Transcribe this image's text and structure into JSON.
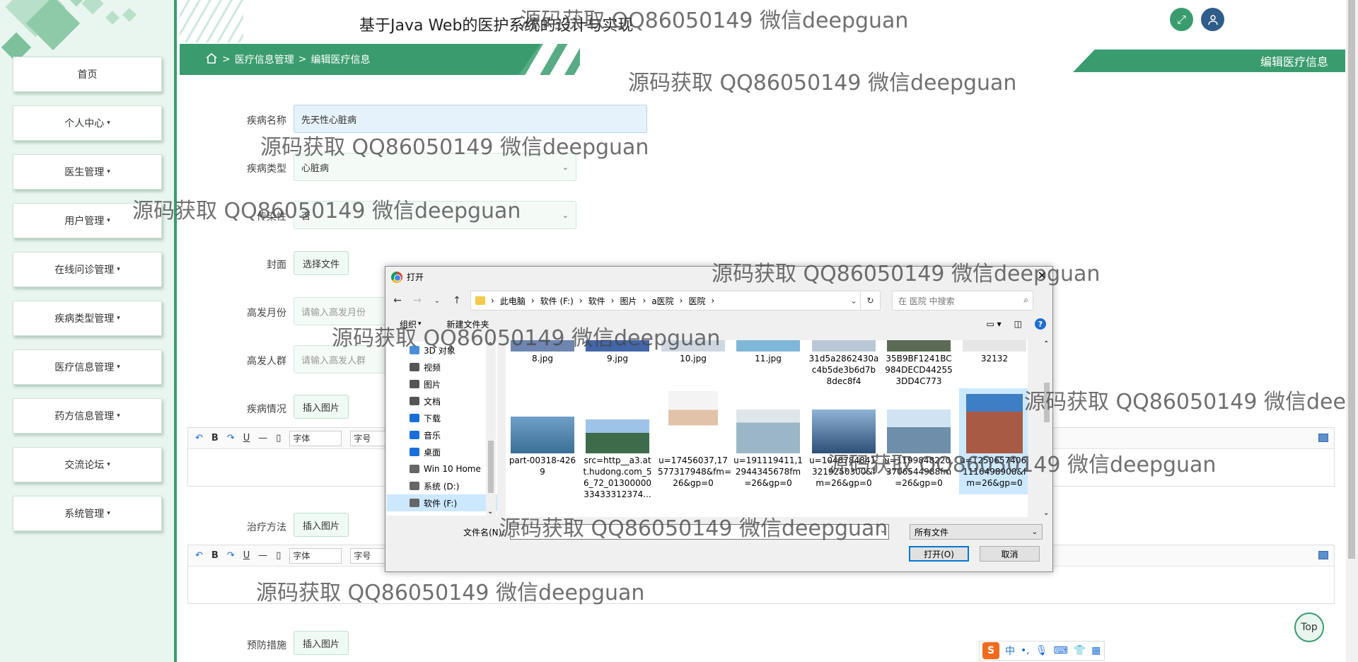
{
  "app": {
    "title": "基于Java Web的医护系统的设计与实现"
  },
  "breadcrumb": {
    "home_icon": "home-icon",
    "items": [
      "医疗信息管理",
      "编辑医疗信息"
    ],
    "sep": ">"
  },
  "page_tag": "编辑医疗信息",
  "sidebar": {
    "items": [
      {
        "label": "首页",
        "has_caret": false
      },
      {
        "label": "个人中心",
        "has_caret": true
      },
      {
        "label": "医生管理",
        "has_caret": true
      },
      {
        "label": "用户管理",
        "has_caret": true
      },
      {
        "label": "在线问诊管理",
        "has_caret": true
      },
      {
        "label": "疾病类型管理",
        "has_caret": true
      },
      {
        "label": "医疗信息管理",
        "has_caret": true
      },
      {
        "label": "药方信息管理",
        "has_caret": true
      },
      {
        "label": "交流论坛",
        "has_caret": true
      },
      {
        "label": "系统管理",
        "has_caret": true
      }
    ],
    "caret": "▾"
  },
  "form": {
    "disease_name": {
      "label": "疾病名称",
      "value": "先天性心脏病"
    },
    "disease_type": {
      "label": "疾病类型",
      "value": "心脏病"
    },
    "contagious": {
      "label": "传染性",
      "value": "否"
    },
    "cover": {
      "label": "封面",
      "button": "选择文件"
    },
    "peak_month": {
      "label": "高发月份",
      "placeholder": "请输入高发月份"
    },
    "peak_group": {
      "label": "高发人群",
      "placeholder": "请输入高发人群"
    },
    "condition": {
      "label": "疾病情况",
      "button": "插入图片"
    },
    "treatment": {
      "label": "治疗方法",
      "button": "插入图片"
    },
    "prevention": {
      "label": "预防措施",
      "button": "插入图片"
    },
    "editor_toolbar": {
      "font": "字体",
      "size": "字号",
      "bold": "B",
      "underline": "U",
      "hr": "—"
    }
  },
  "watermark": "源码获取 QQ86050149 微信deepguan",
  "dialog": {
    "title": "打开",
    "path": [
      "此电脑",
      "软件 (F:)",
      "软件",
      "图片",
      "a医院",
      "医院"
    ],
    "search_placeholder": "在 医院 中搜索",
    "organize": "组织",
    "new_folder": "新建文件夹",
    "tree": [
      {
        "label": "3D 对象",
        "icon": "cube-icon"
      },
      {
        "label": "视频",
        "icon": "video-icon"
      },
      {
        "label": "图片",
        "icon": "picture-icon"
      },
      {
        "label": "文档",
        "icon": "document-icon"
      },
      {
        "label": "下载",
        "icon": "download-icon"
      },
      {
        "label": "音乐",
        "icon": "music-icon"
      },
      {
        "label": "桌面",
        "icon": "desktop-icon"
      },
      {
        "label": "Win 10 Home",
        "icon": "drive-icon"
      },
      {
        "label": "系统 (D:)",
        "icon": "drive-icon"
      },
      {
        "label": "软件 (F:)",
        "icon": "drive-icon"
      }
    ],
    "files_row1": [
      "8.jpg",
      "9.jpg",
      "10.jpg",
      "11.jpg",
      "31d5a2862430a c4b5de3b6d7b 8dec8f4",
      "35B9BF1241BC 984DECD44255 3DD4C773",
      "32132"
    ],
    "files_row2": [
      "part-00318-426 9",
      "src=http__a3.at t.hudong.com_5 6_72_01300000 33433312374...",
      "u=17456037,17 577317948&fm= 26&gp=0",
      "u=191119411,1 2944345678fm =26&gp=0",
      "u=1048784841, 3219250300&f m=26&gp=0",
      "u=1199848220, 3706544988fm =26&gp=0",
      "u=1250657406, 1116498900&f m=26&gp=0"
    ],
    "filename_label": "文件名(N):",
    "filetype": "所有文件",
    "open_button": "打开(O)",
    "cancel_button": "取消"
  },
  "top_button": "Top",
  "ime": {
    "mode": "中",
    "logo": "S"
  }
}
